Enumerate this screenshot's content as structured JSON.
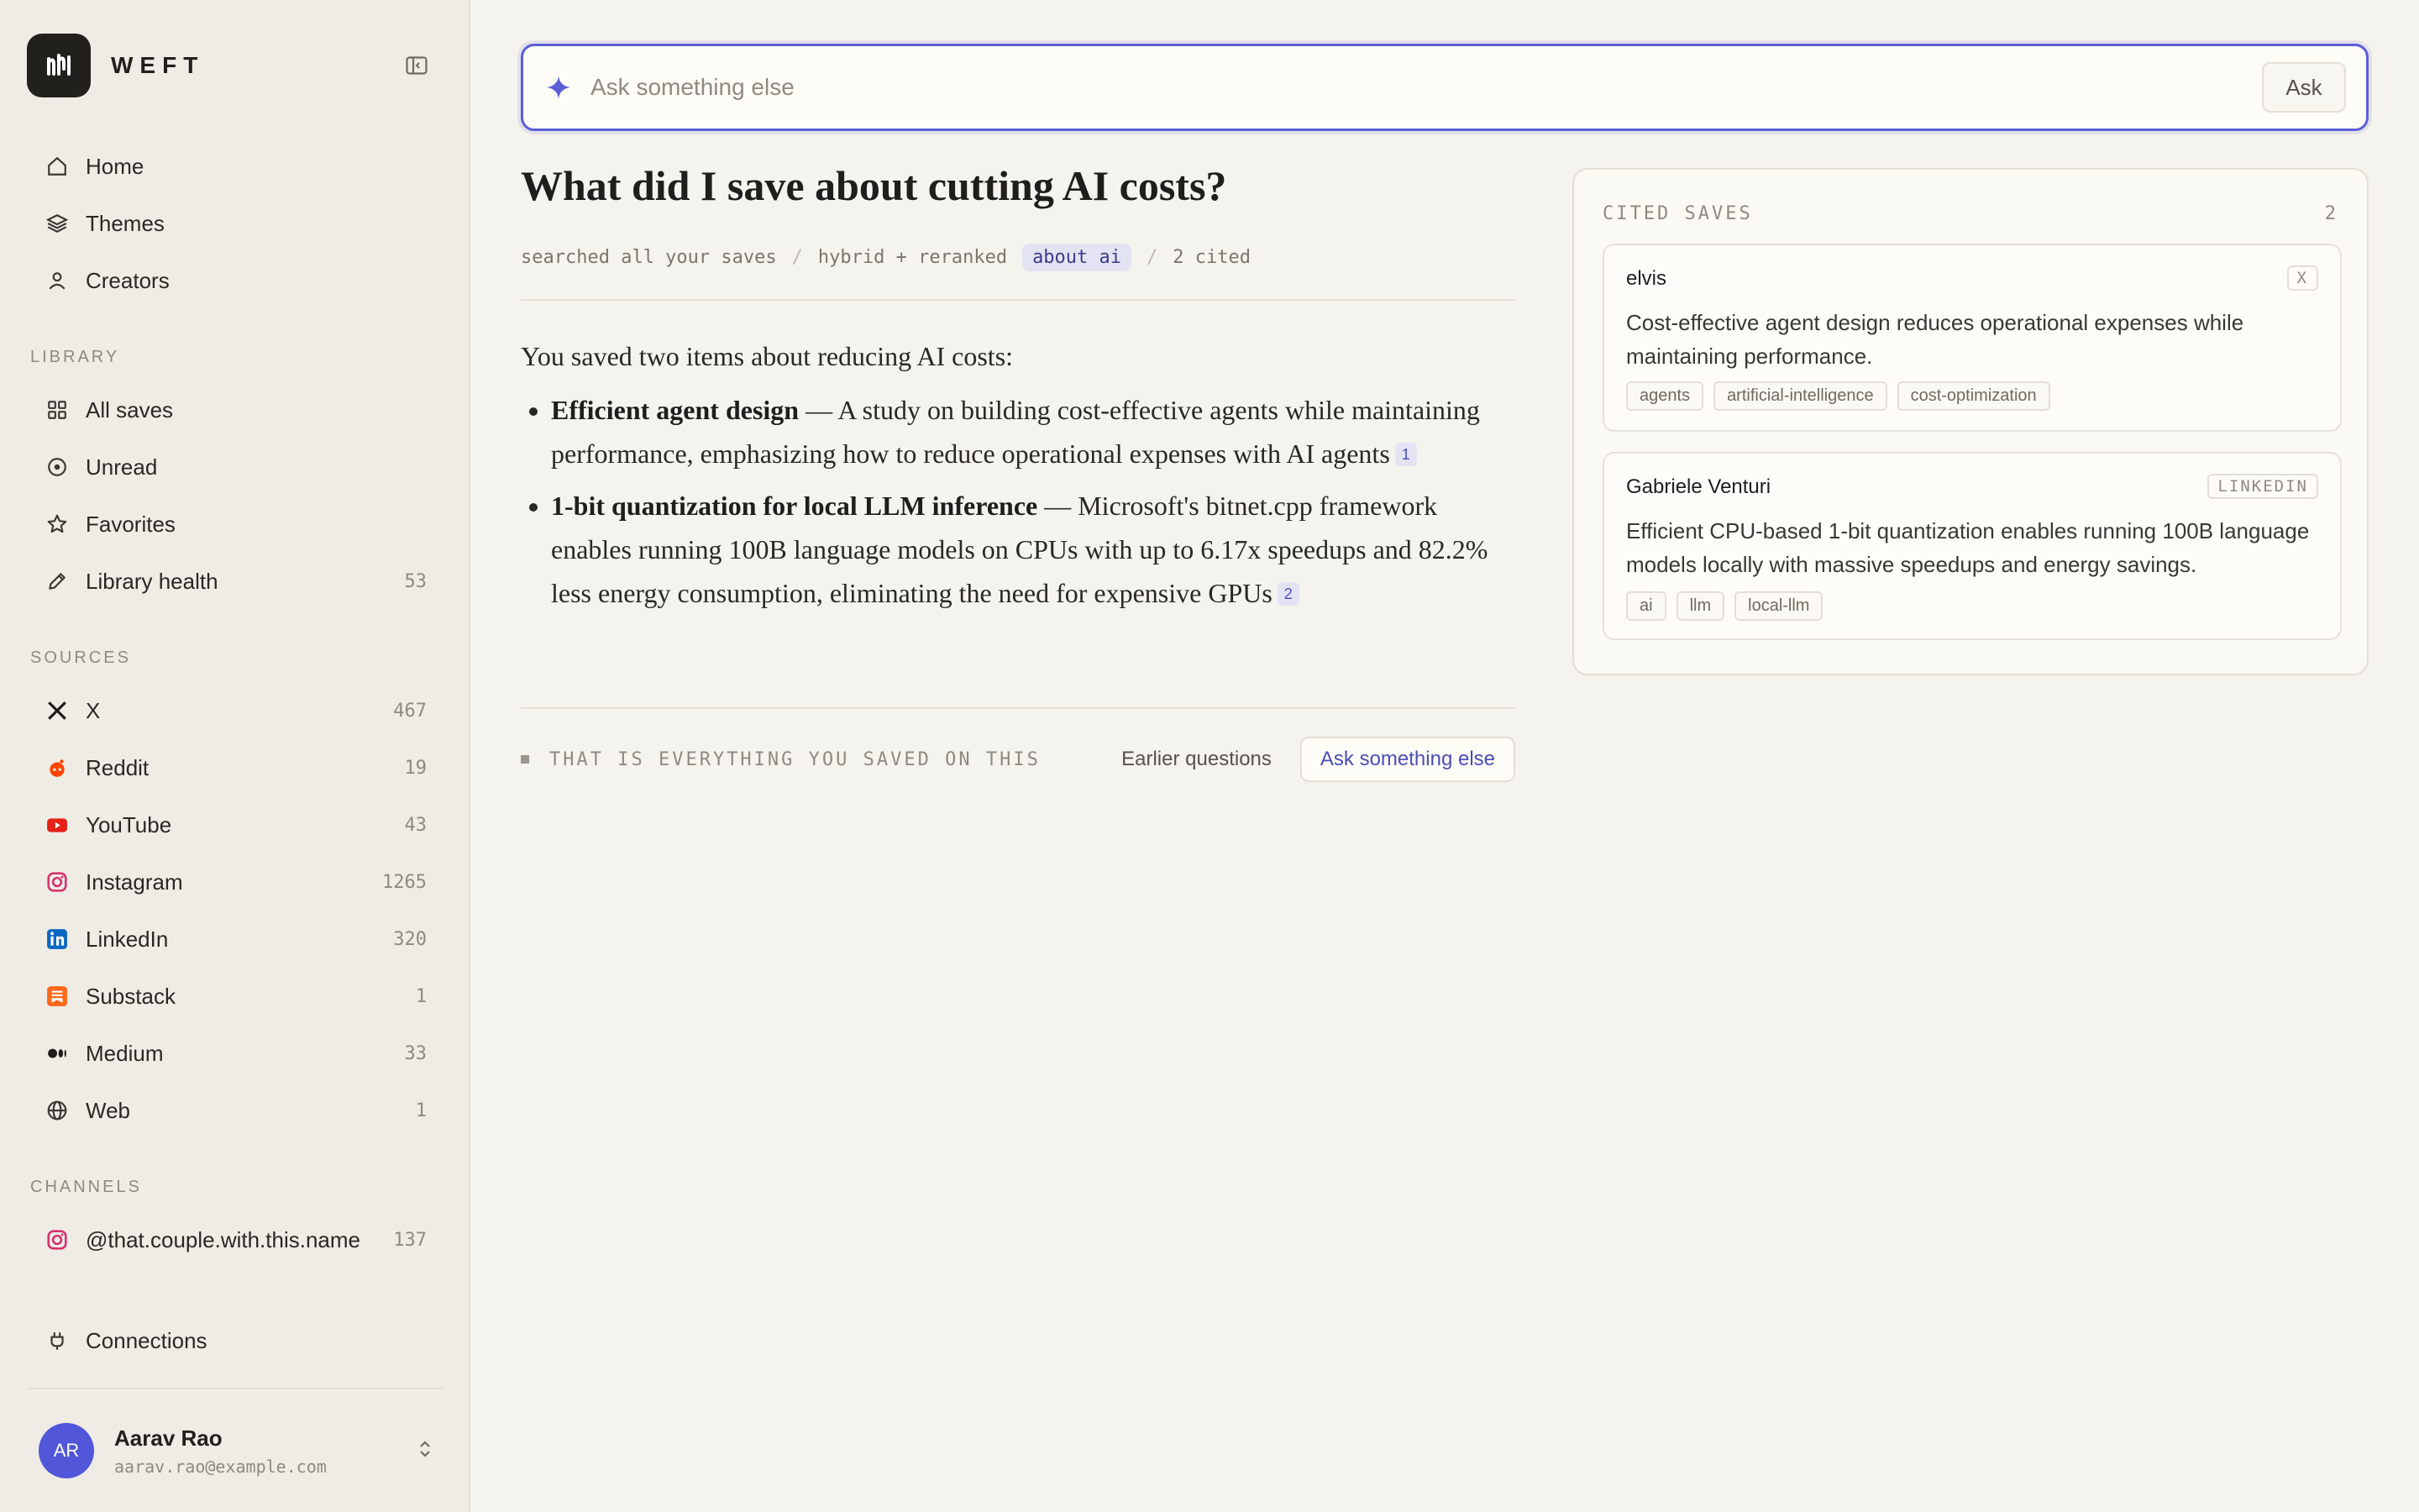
{
  "app": {
    "name": "WEFT"
  },
  "nav": {
    "primary": [
      {
        "label": "Home",
        "icon": "home-icon"
      },
      {
        "label": "Themes",
        "icon": "layers-icon"
      },
      {
        "label": "Creators",
        "icon": "user-icon"
      }
    ],
    "library_label": "LIBRARY",
    "library": [
      {
        "label": "All saves",
        "icon": "grid-icon"
      },
      {
        "label": "Unread",
        "icon": "dot-circle-icon"
      },
      {
        "label": "Favorites",
        "icon": "star-icon"
      },
      {
        "label": "Library health",
        "icon": "pencil-icon",
        "count": "53"
      }
    ],
    "sources_label": "SOURCES",
    "sources": [
      {
        "label": "X",
        "icon": "x-logo-icon",
        "count": "467"
      },
      {
        "label": "Reddit",
        "icon": "reddit-icon",
        "count": "19"
      },
      {
        "label": "YouTube",
        "icon": "youtube-icon",
        "count": "43"
      },
      {
        "label": "Instagram",
        "icon": "instagram-icon",
        "count": "1265"
      },
      {
        "label": "LinkedIn",
        "icon": "linkedin-icon",
        "count": "320"
      },
      {
        "label": "Substack",
        "icon": "substack-icon",
        "count": "1"
      },
      {
        "label": "Medium",
        "icon": "medium-icon",
        "count": "33"
      },
      {
        "label": "Web",
        "icon": "globe-icon",
        "count": "1"
      }
    ],
    "channels_label": "CHANNELS",
    "channels": [
      {
        "label": "@that.couple.with.this.name",
        "icon": "instagram-icon",
        "count": "137"
      }
    ],
    "connections": {
      "label": "Connections",
      "icon": "plug-icon"
    }
  },
  "user": {
    "initials": "AR",
    "name": "Aarav Rao",
    "email": "aarav.rao@example.com"
  },
  "ask": {
    "placeholder": "Ask something else",
    "button": "Ask"
  },
  "query": {
    "question": "What did I save about cutting AI costs?",
    "meta": {
      "scope": "searched all your saves",
      "method": "hybrid + reranked",
      "topic": "about ai",
      "cited": "2 cited",
      "separator": "/"
    }
  },
  "answer": {
    "intro": "You saved two items about reducing AI costs:",
    "items": [
      {
        "title": "Efficient agent design",
        "text": " — A study on building cost-effective agents while maintaining performance, emphasizing how to reduce operational expenses with AI agents",
        "cite": "1"
      },
      {
        "title": "1-bit quantization for local LLM inference",
        "text": " — Microsoft's bitnet.cpp framework enables running 100B language models on CPUs with up to 6.17x speedups and 82.2% less energy consumption, eliminating the need for expensive GPUs",
        "cite": "2"
      }
    ]
  },
  "footer": {
    "done": "THAT IS EVERYTHING YOU SAVED ON THIS",
    "earlier": "Earlier questions",
    "ask_else": "Ask something else"
  },
  "cited": {
    "label": "CITED SAVES",
    "count": "2",
    "cards": [
      {
        "author": "elvis",
        "source": "X",
        "summary": "Cost-effective agent design reduces operational expenses while maintaining performance.",
        "tags": [
          "agents",
          "artificial-intelligence",
          "cost-optimization"
        ]
      },
      {
        "author": "Gabriele Venturi",
        "source": "LINKEDIN",
        "summary": "Efficient CPU-based 1-bit quantization enables running 100B language models locally with massive speedups and energy savings.",
        "tags": [
          "ai",
          "llm",
          "local-llm"
        ]
      }
    ]
  },
  "colors": {
    "accent": "#5b5ed6",
    "sidebar_bg": "#efece6",
    "main_bg": "#f5f3ee",
    "reddit": "#ff4500",
    "youtube": "#e62117",
    "instagram": "#d6336c",
    "linkedin": "#0a66c2",
    "substack": "#ff6719"
  }
}
